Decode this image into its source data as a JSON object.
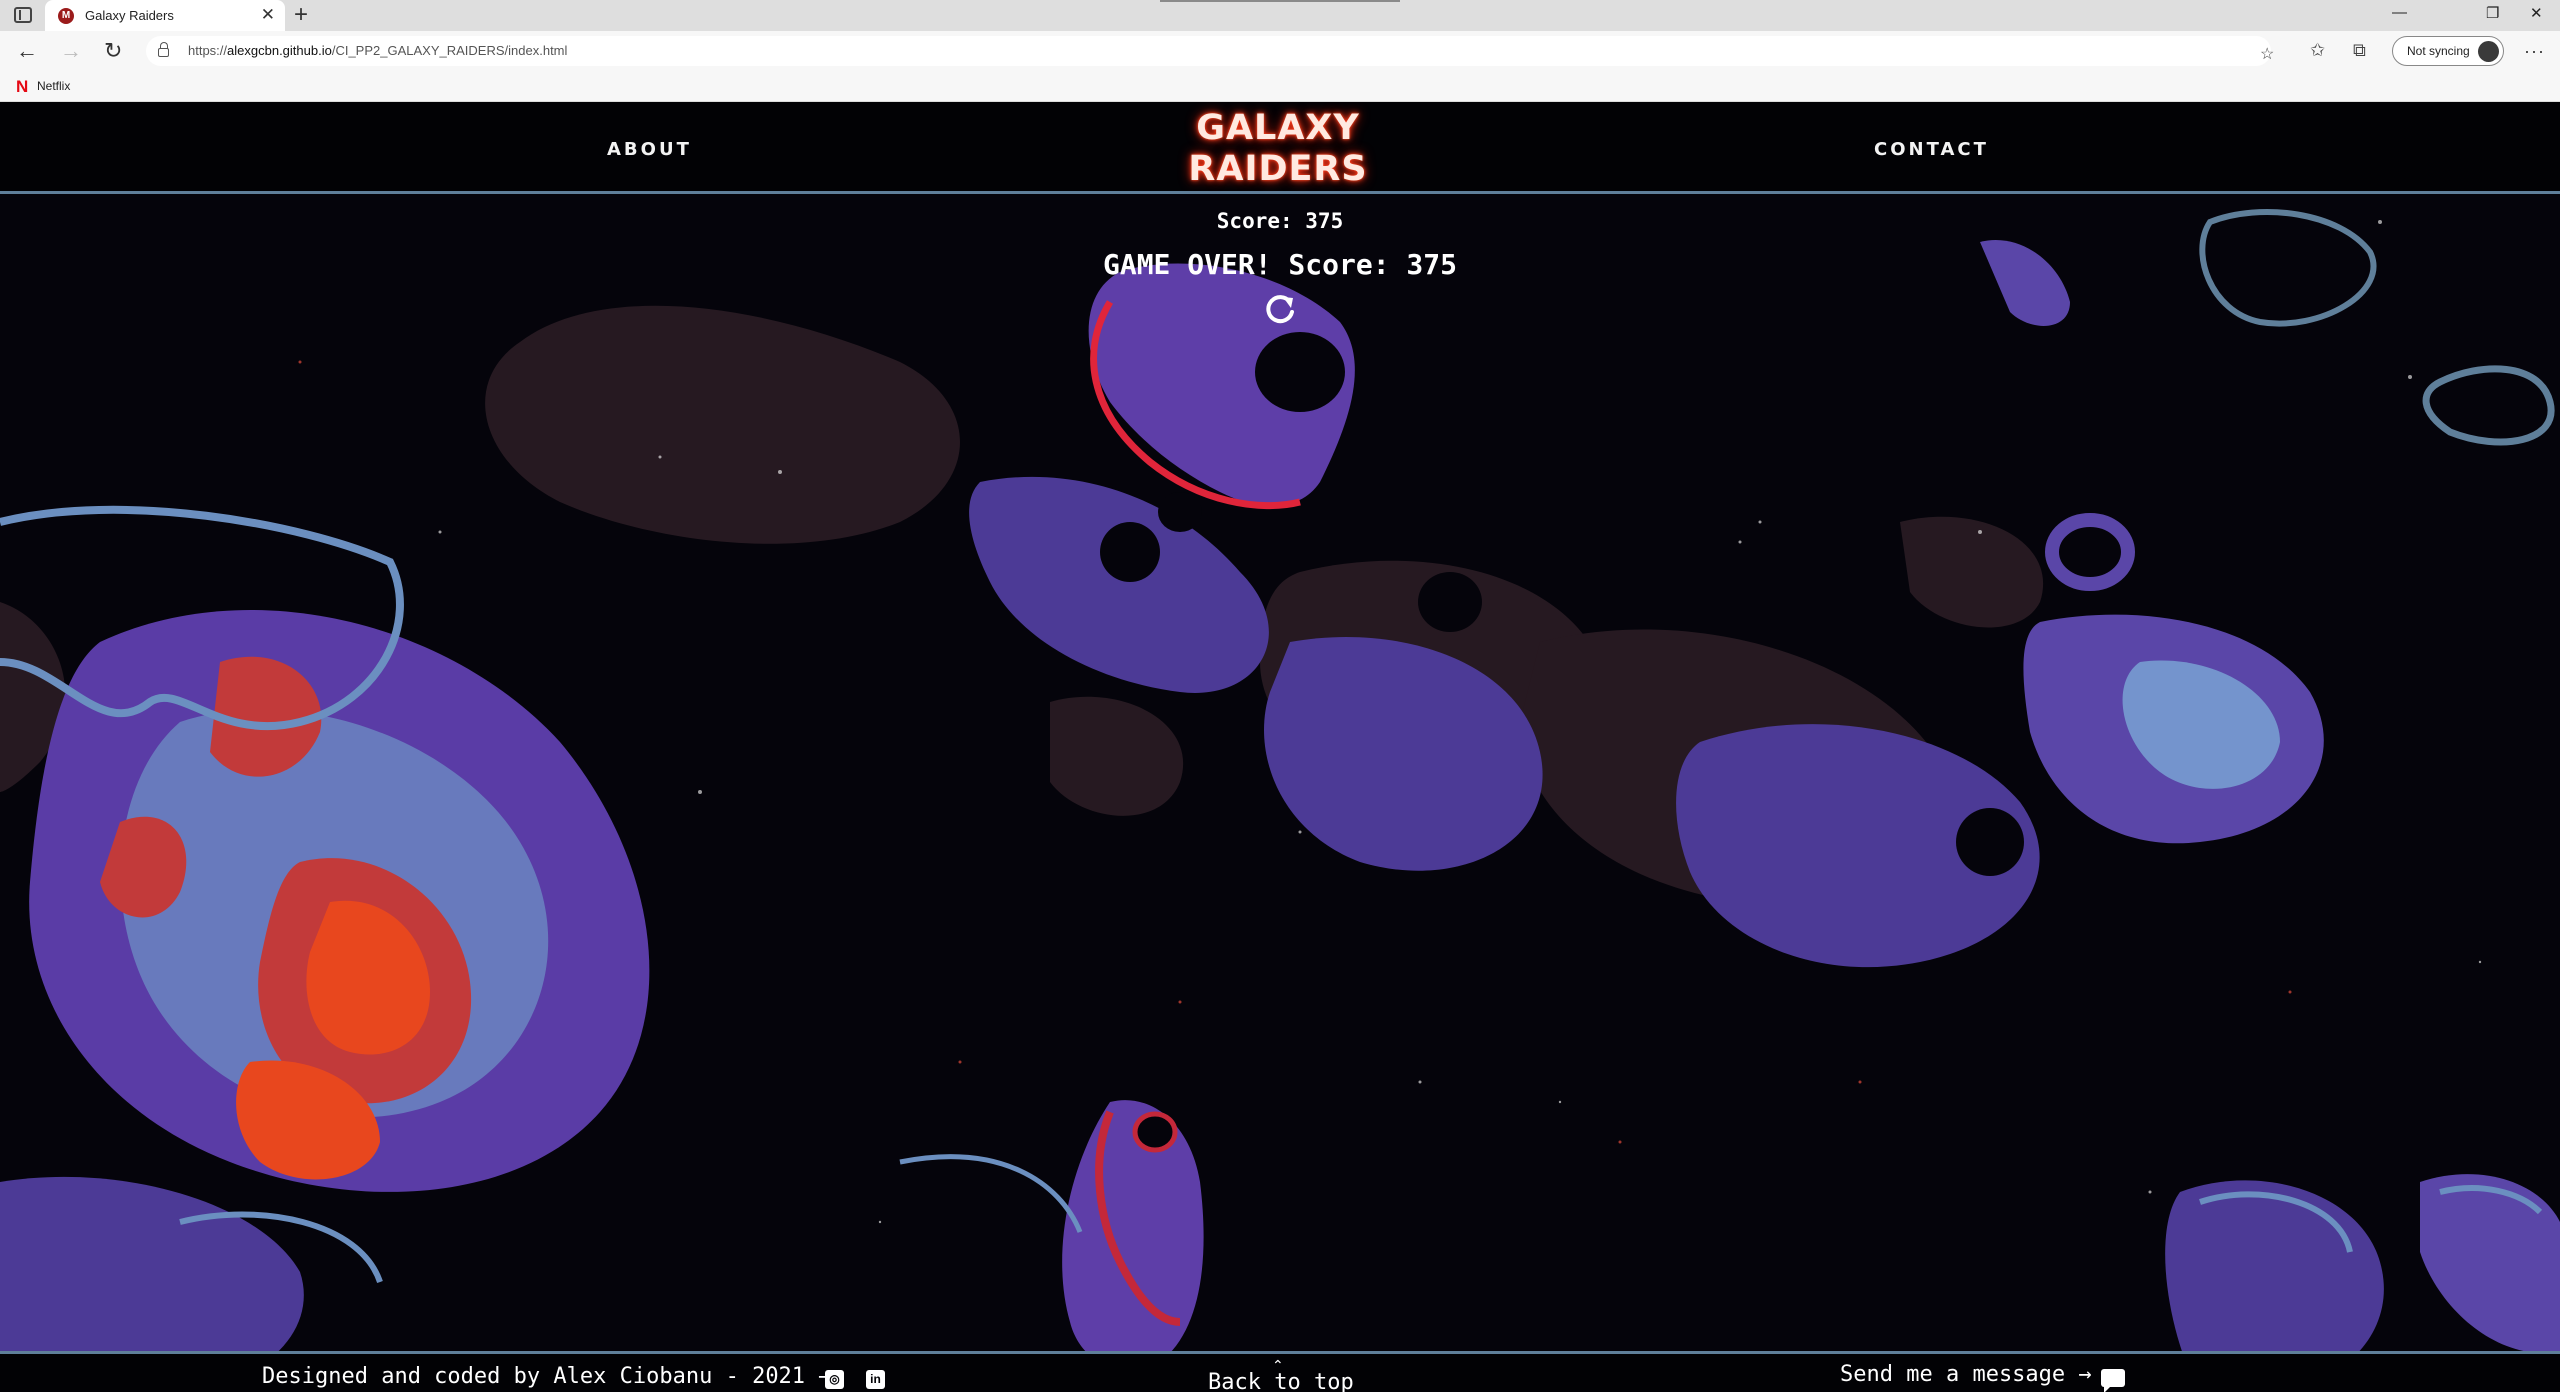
{
  "browser": {
    "tab_title": "Galaxy Raiders",
    "tab_favicon": "M",
    "url_prefix": "https://",
    "url_host": "alexgcbn.github.io",
    "url_path": "/CI_PP2_GALAXY_RAIDERS/index.html",
    "sync_label": "Not syncing",
    "favorites": [
      {
        "icon": "N",
        "label": "Netflix"
      }
    ],
    "icons": [
      "sidebar-toggle-icon",
      "tab-close-icon",
      "new-tab-icon",
      "back-arrow-icon",
      "forward-arrow-icon",
      "refresh-icon",
      "lock-icon",
      "add-favorite-icon",
      "favorites-icon",
      "collections-icon",
      "profile-avatar",
      "more-menu-icon",
      "minimize-icon",
      "restore-icon",
      "close-window-icon"
    ]
  },
  "site": {
    "nav_about": "ABOUT",
    "nav_contact": "CONTACT",
    "logo_line1": "GALAXY",
    "logo_line2": "RAIDERS",
    "logo_color": "#ff3a1a",
    "border_color": "#5f7f9a"
  },
  "game": {
    "score_text": "Score: 375",
    "game_over_text": "GAME OVER! Score: 375",
    "restart_icon": "restart-icon"
  },
  "footer": {
    "credit": "Designed and coded by Alex Ciobanu - 2021 →",
    "github_icon": "github-icon",
    "linkedin_icon": "linkedin-icon",
    "back_to_top": "Back to top",
    "message": "Send me a message →",
    "message_icon": "message-icon"
  }
}
